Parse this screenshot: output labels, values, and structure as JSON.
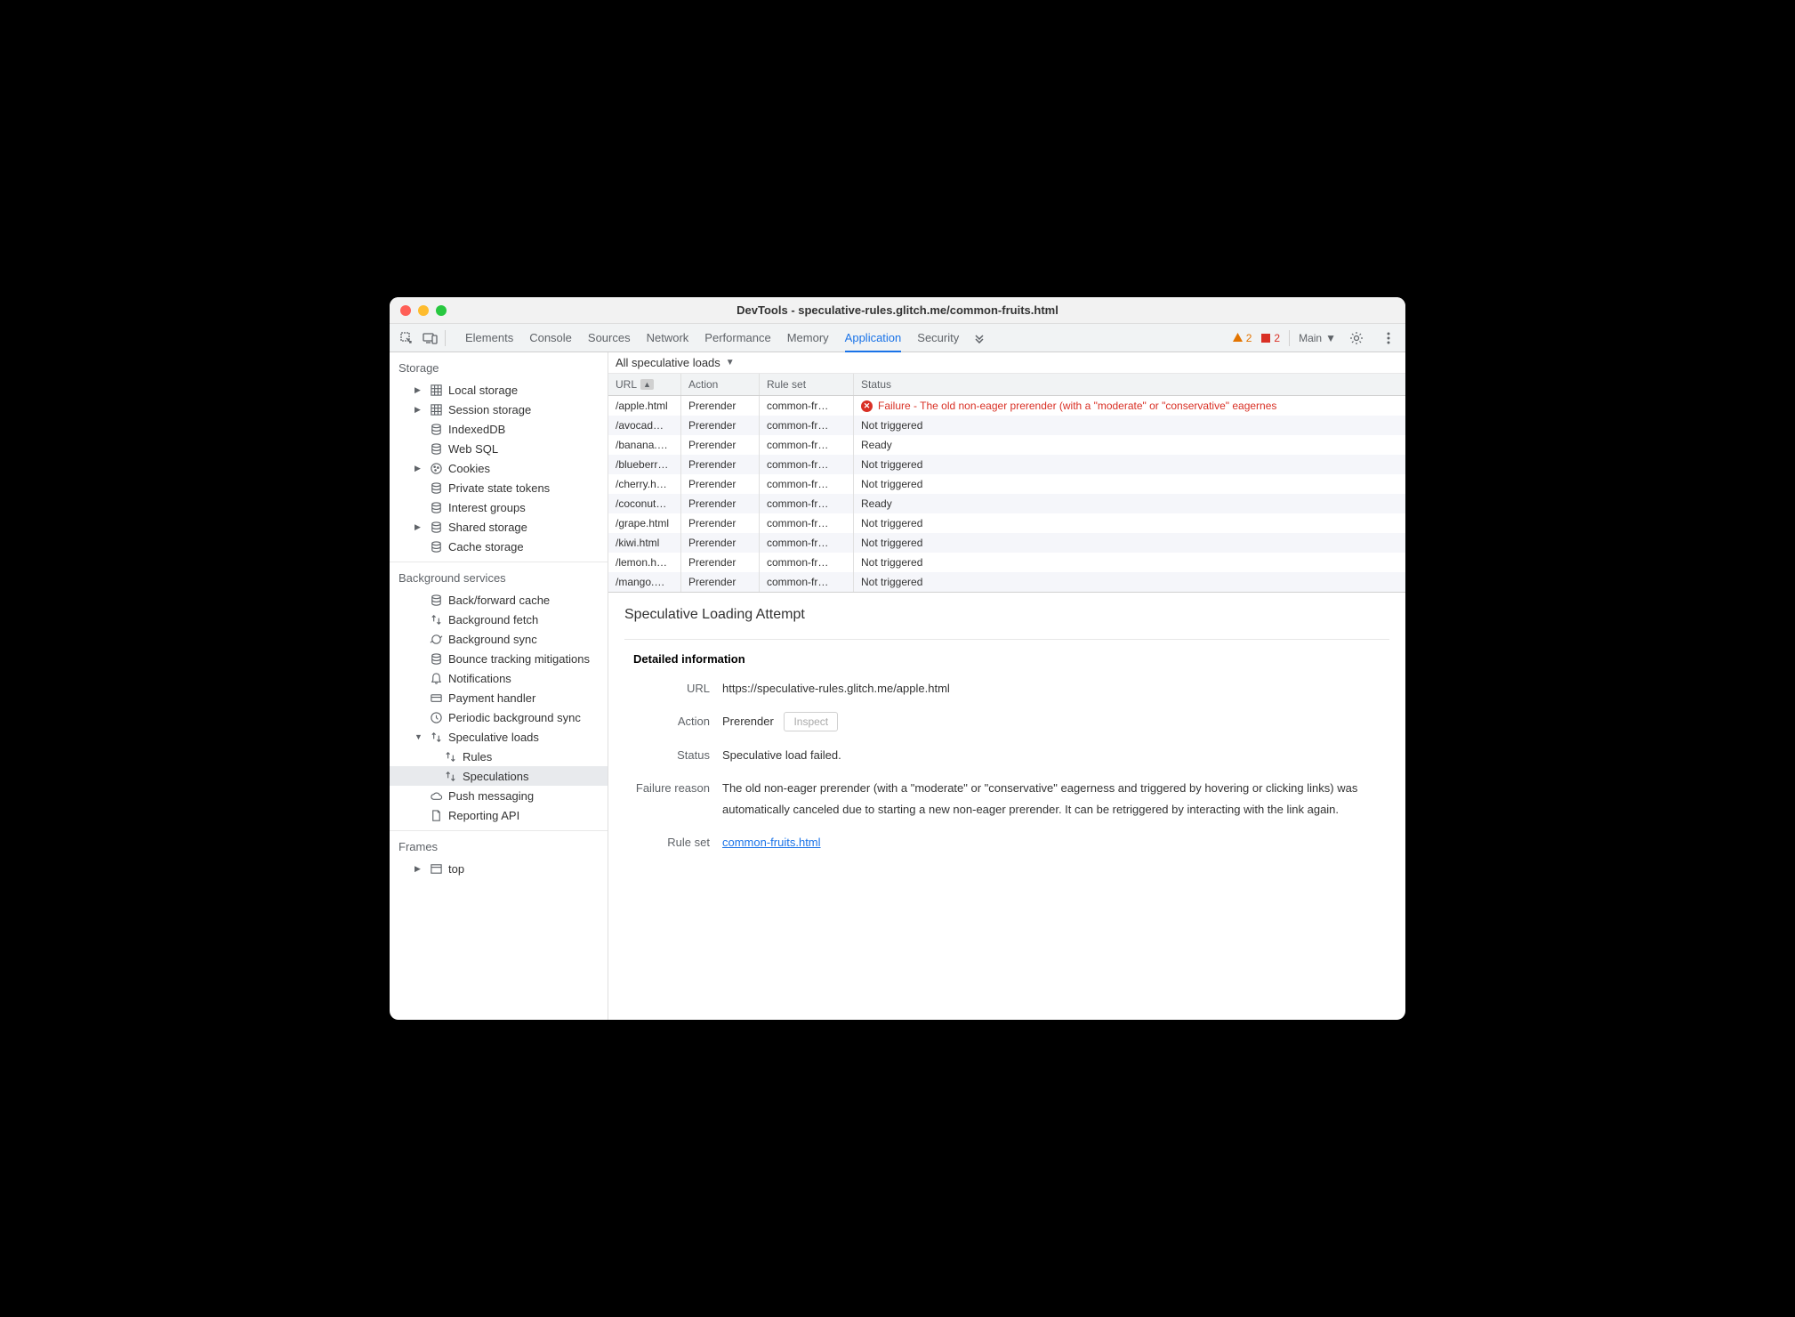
{
  "window_title": "DevTools - speculative-rules.glitch.me/common-fruits.html",
  "tabs": [
    "Elements",
    "Console",
    "Sources",
    "Network",
    "Performance",
    "Memory",
    "Application",
    "Security"
  ],
  "active_tab": "Application",
  "warnings_count": "2",
  "errors_count": "2",
  "main_selector": "Main",
  "sidebar": {
    "storage_title": "Storage",
    "storage_items": [
      {
        "label": "Local storage",
        "icon": "grid",
        "exp": true
      },
      {
        "label": "Session storage",
        "icon": "grid",
        "exp": true
      },
      {
        "label": "IndexedDB",
        "icon": "db",
        "exp": false
      },
      {
        "label": "Web SQL",
        "icon": "db",
        "exp": false
      },
      {
        "label": "Cookies",
        "icon": "cookie",
        "exp": true
      },
      {
        "label": "Private state tokens",
        "icon": "db",
        "exp": false
      },
      {
        "label": "Interest groups",
        "icon": "db",
        "exp": false
      },
      {
        "label": "Shared storage",
        "icon": "db",
        "exp": true
      },
      {
        "label": "Cache storage",
        "icon": "db",
        "exp": false
      }
    ],
    "bg_title": "Background services",
    "bg_items": [
      {
        "label": "Back/forward cache",
        "icon": "db"
      },
      {
        "label": "Background fetch",
        "icon": "updown"
      },
      {
        "label": "Background sync",
        "icon": "sync"
      },
      {
        "label": "Bounce tracking mitigations",
        "icon": "db"
      },
      {
        "label": "Notifications",
        "icon": "bell"
      },
      {
        "label": "Payment handler",
        "icon": "card"
      },
      {
        "label": "Periodic background sync",
        "icon": "clock"
      },
      {
        "label": "Speculative loads",
        "icon": "updown",
        "expanded": true,
        "children": [
          {
            "label": "Rules",
            "icon": "updown"
          },
          {
            "label": "Speculations",
            "icon": "updown",
            "selected": true
          }
        ]
      },
      {
        "label": "Push messaging",
        "icon": "cloud"
      },
      {
        "label": "Reporting API",
        "icon": "file"
      }
    ],
    "frames_title": "Frames",
    "frames_items": [
      {
        "label": "top",
        "icon": "frame",
        "exp": true
      }
    ]
  },
  "filter_label": "All speculative loads",
  "table": {
    "headers": {
      "url": "URL",
      "action": "Action",
      "ruleset": "Rule set",
      "status": "Status"
    },
    "rows": [
      {
        "url": "/apple.html",
        "action": "Prerender",
        "ruleset": "common-fr…",
        "status": "Failure - The old non-eager prerender (with a \"moderate\" or \"conservative\" eagernes",
        "error": true
      },
      {
        "url": "/avocad…",
        "action": "Prerender",
        "ruleset": "common-fr…",
        "status": "Not triggered"
      },
      {
        "url": "/banana.…",
        "action": "Prerender",
        "ruleset": "common-fr…",
        "status": "Ready"
      },
      {
        "url": "/blueberr…",
        "action": "Prerender",
        "ruleset": "common-fr…",
        "status": "Not triggered"
      },
      {
        "url": "/cherry.h…",
        "action": "Prerender",
        "ruleset": "common-fr…",
        "status": "Not triggered"
      },
      {
        "url": "/coconut…",
        "action": "Prerender",
        "ruleset": "common-fr…",
        "status": "Ready"
      },
      {
        "url": "/grape.html",
        "action": "Prerender",
        "ruleset": "common-fr…",
        "status": "Not triggered"
      },
      {
        "url": "/kiwi.html",
        "action": "Prerender",
        "ruleset": "common-fr…",
        "status": "Not triggered"
      },
      {
        "url": "/lemon.h…",
        "action": "Prerender",
        "ruleset": "common-fr…",
        "status": "Not triggered"
      },
      {
        "url": "/mango.…",
        "action": "Prerender",
        "ruleset": "common-fr…",
        "status": "Not triggered"
      }
    ]
  },
  "detail": {
    "title": "Speculative Loading Attempt",
    "section_title": "Detailed information",
    "url_label": "URL",
    "url_value": "https://speculative-rules.glitch.me/apple.html",
    "action_label": "Action",
    "action_value": "Prerender",
    "inspect_label": "Inspect",
    "status_label": "Status",
    "status_value": "Speculative load failed.",
    "failure_label": "Failure reason",
    "failure_value": "The old non-eager prerender (with a \"moderate\" or \"conservative\" eagerness and triggered by hovering or clicking links) was automatically canceled due to starting a new non-eager prerender. It can be retriggered by interacting with the link again.",
    "ruleset_label": "Rule set",
    "ruleset_value": "common-fruits.html"
  }
}
